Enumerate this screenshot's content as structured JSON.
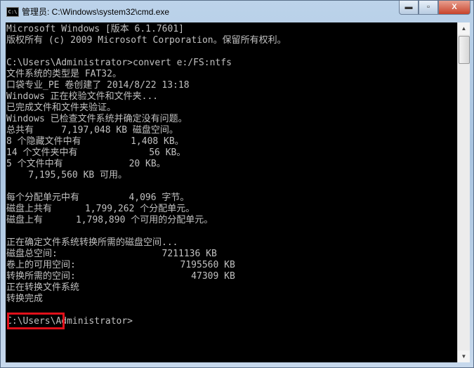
{
  "window": {
    "title": "管理员: C:\\Windows\\system32\\cmd.exe",
    "icon": "cmd-icon",
    "icon_text": "C:\\",
    "controls": {
      "minimize": "▬",
      "maximize": "▫",
      "close": "X"
    }
  },
  "terminal": {
    "highlight_color": "#e0101a",
    "lines": [
      "Microsoft Windows [版本 6.1.7601]",
      "版权所有 (c) 2009 Microsoft Corporation。保留所有权利。",
      "",
      "C:\\Users\\Administrator>convert e:/FS:ntfs",
      "文件系统的类型是 FAT32。",
      "口袋专业_PE 卷创建了 2014/8/22 13:18",
      "Windows 正在校验文件和文件夹...",
      "已完成文件和文件夹验证。",
      "Windows 已检查文件系统并确定没有问题。",
      "总共有     7,197,048 KB 磁盘空间。",
      "8 个隐藏文件中有         1,408 KB。",
      "14 个文件夹中有             56 KB。",
      "5 个文件中有            20 KB。",
      "    7,195,560 KB 可用。",
      "",
      "每个分配单元中有         4,096 字节。",
      "磁盘上共有      1,799,262 个分配单元。",
      "磁盘上有      1,798,890 个可用的分配单元。",
      "",
      "正在确定文件系统转换所需的磁盘空间...",
      "磁盘总空间:                   7211136 KB",
      "卷上的可用空间:                   7195560 KB",
      "转换所需的空间:                     47309 KB",
      "正在转换文件系统",
      "转换完成",
      "",
      "C:\\Users\\Administrator>"
    ]
  }
}
